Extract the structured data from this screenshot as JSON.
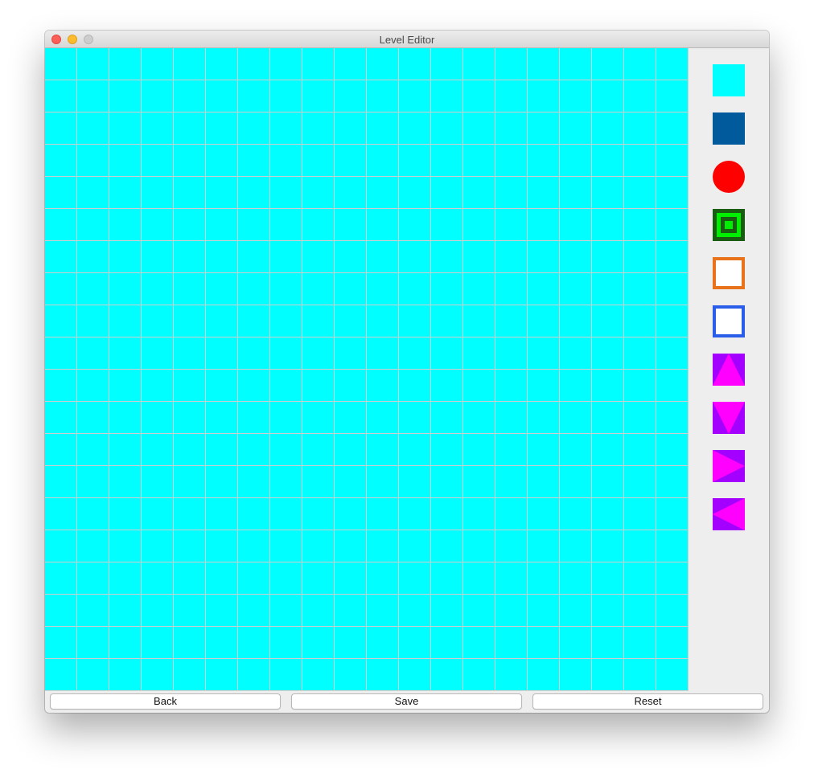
{
  "window": {
    "title": "Level Editor"
  },
  "grid": {
    "columns": 20,
    "rows": 20,
    "fill_color": "#00ffff",
    "line_color": "#cfcfcf"
  },
  "palette": [
    {
      "name": "empty-tile",
      "color": "#00ffff"
    },
    {
      "name": "wall-tile",
      "color": "#005a9c"
    },
    {
      "name": "ball-tile",
      "color": "#ff0000"
    },
    {
      "name": "goal-tile",
      "colors": [
        "#1a5c12",
        "#00ee00"
      ]
    },
    {
      "name": "orange-block-tile",
      "colors": [
        "#e8731a",
        "#ffffff"
      ]
    },
    {
      "name": "blue-block-tile",
      "colors": [
        "#2a5ee8",
        "#ffffff"
      ]
    },
    {
      "name": "arrow-up-tile",
      "colors": [
        "#a400ff",
        "#ff00ff"
      ]
    },
    {
      "name": "arrow-down-tile",
      "colors": [
        "#a400ff",
        "#ff00ff"
      ]
    },
    {
      "name": "arrow-right-tile",
      "colors": [
        "#a400ff",
        "#ff00ff"
      ]
    },
    {
      "name": "arrow-left-tile",
      "colors": [
        "#a400ff",
        "#ff00ff"
      ]
    }
  ],
  "buttons": {
    "back": "Back",
    "save": "Save",
    "reset": "Reset"
  }
}
